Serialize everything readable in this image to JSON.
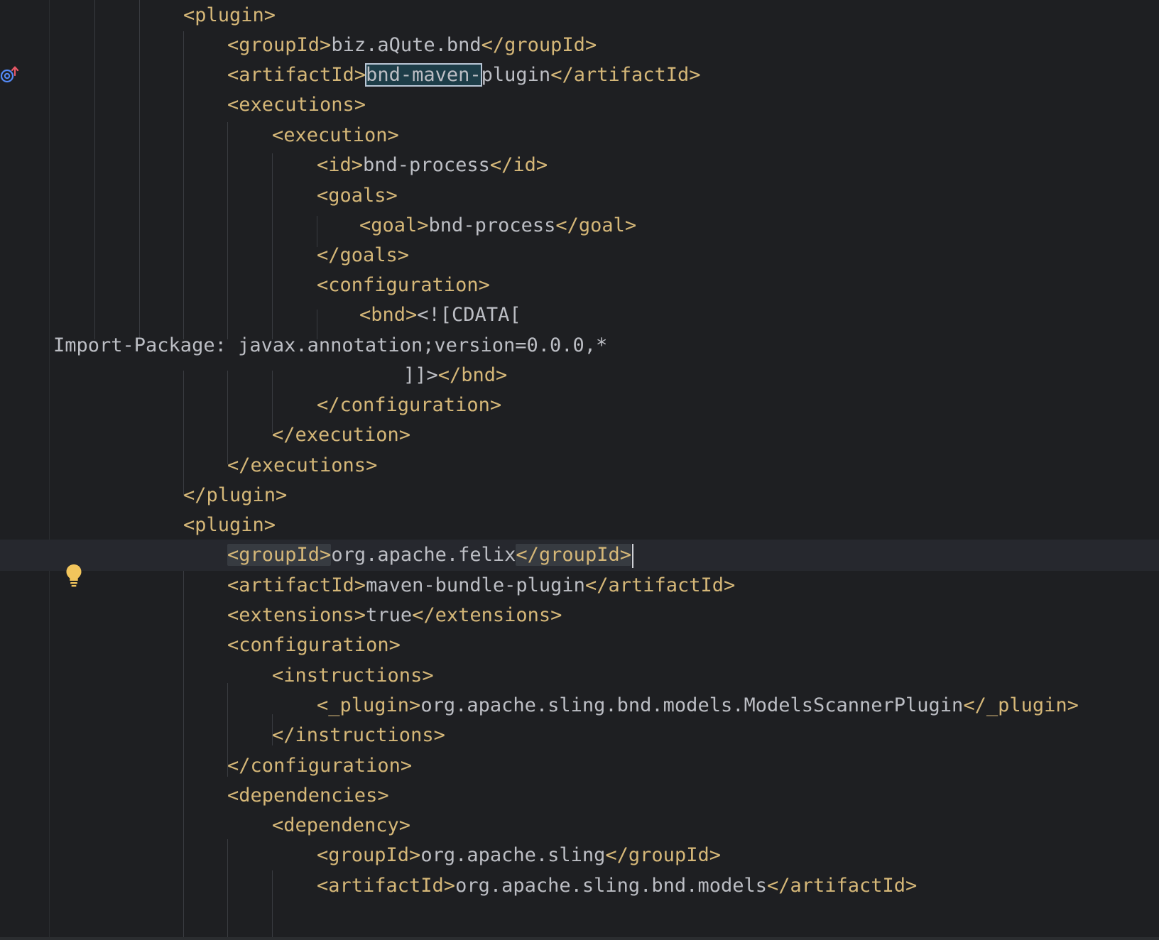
{
  "editor": {
    "lines": [
      {
        "parts": [
          {
            "t": "<plugin>",
            "c": "tag"
          }
        ]
      },
      {
        "parts": [
          {
            "t": "<groupId>",
            "c": "tag"
          },
          {
            "t": "biz.aQute.bnd",
            "c": "val"
          },
          {
            "t": "</groupId>",
            "c": "tag"
          }
        ]
      },
      {
        "parts": [
          {
            "t": "<artifactId>",
            "c": "tag"
          },
          {
            "t": "bnd-maven-",
            "c": "val sel"
          },
          {
            "t": "plugin",
            "c": "val"
          },
          {
            "t": "</artifactId>",
            "c": "tag"
          }
        ]
      },
      {
        "parts": [
          {
            "t": "<executions>",
            "c": "tag"
          }
        ]
      },
      {
        "parts": [
          {
            "t": "<execution>",
            "c": "tag"
          }
        ]
      },
      {
        "parts": [
          {
            "t": "<id>",
            "c": "tag"
          },
          {
            "t": "bnd-process",
            "c": "val"
          },
          {
            "t": "</id>",
            "c": "tag"
          }
        ]
      },
      {
        "parts": [
          {
            "t": "<goals>",
            "c": "tag"
          }
        ]
      },
      {
        "parts": [
          {
            "t": "<goal>",
            "c": "tag"
          },
          {
            "t": "bnd-process",
            "c": "val"
          },
          {
            "t": "</goal>",
            "c": "tag"
          }
        ]
      },
      {
        "parts": [
          {
            "t": "</goals>",
            "c": "tag"
          }
        ]
      },
      {
        "parts": [
          {
            "t": "<configuration>",
            "c": "tag"
          }
        ]
      },
      {
        "parts": [
          {
            "t": "<bnd>",
            "c": "tag"
          },
          {
            "t": "<![CDATA[",
            "c": "val"
          }
        ]
      },
      {
        "parts": [
          {
            "t": "Import-Package: javax.annotation;version=0.0.0,*",
            "c": "val"
          }
        ]
      },
      {
        "parts": [
          {
            "t": "]]>",
            "c": "val"
          },
          {
            "t": "</bnd>",
            "c": "tag"
          }
        ]
      },
      {
        "parts": [
          {
            "t": "</configuration>",
            "c": "tag"
          }
        ]
      },
      {
        "parts": [
          {
            "t": "</execution>",
            "c": "tag"
          }
        ]
      },
      {
        "parts": [
          {
            "t": "</executions>",
            "c": "tag"
          }
        ]
      },
      {
        "parts": [
          {
            "t": "</plugin>",
            "c": "tag"
          }
        ]
      },
      {
        "parts": [
          {
            "t": "<plugin>",
            "c": "tag"
          }
        ]
      },
      {
        "parts": [
          {
            "t": "<groupId>",
            "c": "tag tag-hl"
          },
          {
            "t": "org.apache.felix",
            "c": "val"
          },
          {
            "t": "</groupId>",
            "c": "tag tag-hl"
          }
        ]
      },
      {
        "parts": [
          {
            "t": "<artifactId>",
            "c": "tag"
          },
          {
            "t": "maven-bundle-plugin",
            "c": "val"
          },
          {
            "t": "</artifactId>",
            "c": "tag"
          }
        ]
      },
      {
        "parts": [
          {
            "t": "<extensions>",
            "c": "tag"
          },
          {
            "t": "true",
            "c": "val"
          },
          {
            "t": "</extensions>",
            "c": "tag"
          }
        ]
      },
      {
        "parts": [
          {
            "t": "<configuration>",
            "c": "tag"
          }
        ]
      },
      {
        "parts": [
          {
            "t": "<instructions>",
            "c": "tag"
          }
        ]
      },
      {
        "parts": [
          {
            "t": "<_plugin>",
            "c": "tag"
          },
          {
            "t": "org.apache.sling.bnd.models.ModelsScannerPlugin",
            "c": "val"
          },
          {
            "t": "</_plugin>",
            "c": "tag"
          }
        ]
      },
      {
        "parts": [
          {
            "t": "</instructions>",
            "c": "tag"
          }
        ]
      },
      {
        "parts": [
          {
            "t": "</configuration>",
            "c": "tag"
          }
        ]
      },
      {
        "parts": [
          {
            "t": "<dependencies>",
            "c": "tag"
          }
        ]
      },
      {
        "parts": [
          {
            "t": "<dependency>",
            "c": "tag"
          }
        ]
      },
      {
        "parts": [
          {
            "t": "<groupId>",
            "c": "tag"
          },
          {
            "t": "org.apache.sling",
            "c": "val"
          },
          {
            "t": "</groupId>",
            "c": "tag"
          }
        ]
      },
      {
        "parts": [
          {
            "t": "<artifactId>",
            "c": "tag"
          },
          {
            "t": "org.apache.sling.bnd.models",
            "c": "val"
          },
          {
            "t": "</artifactId>",
            "c": "tag"
          }
        ]
      }
    ]
  },
  "gutter": {
    "implementation_icon": "implemented-up-arrow-icon",
    "intention_icon": "lightbulb-icon"
  },
  "colors": {
    "background": "#1e1f22",
    "tag": "#d5b778",
    "text": "#bcbec4",
    "current_line": "#26282e"
  }
}
